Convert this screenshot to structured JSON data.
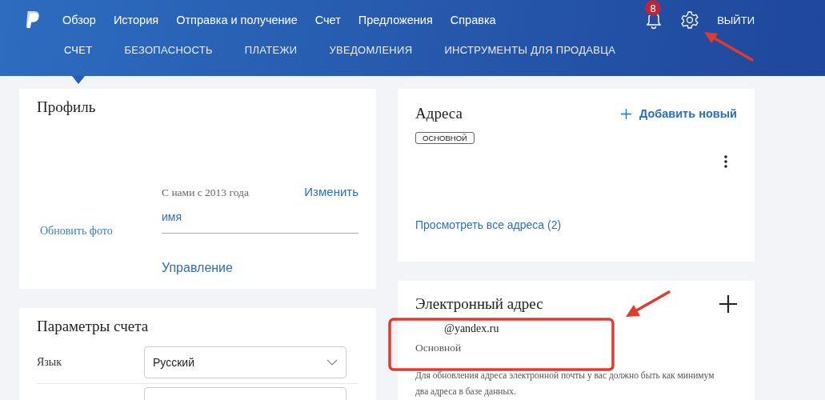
{
  "header": {
    "nav": [
      {
        "label": "Обзор"
      },
      {
        "label": "История"
      },
      {
        "label": "Отправка и получение"
      },
      {
        "label": "Счет"
      },
      {
        "label": "Предложения"
      },
      {
        "label": "Справка"
      }
    ],
    "notifications": {
      "count": "8"
    },
    "logout": "ВЫЙТИ",
    "subnav": [
      {
        "label": "СЧЕТ",
        "selected": true
      },
      {
        "label": "БЕЗОПАСНОСТЬ",
        "selected": false
      },
      {
        "label": "ПЛАТЕЖИ",
        "selected": false
      },
      {
        "label": "УВЕДОМЛЕНИЯ",
        "selected": false
      },
      {
        "label": "ИНСТРУМЕНТЫ ДЛЯ ПРОДАВЦА",
        "selected": false
      }
    ]
  },
  "profile": {
    "title": "Профиль",
    "update_photo": "Обновить фото",
    "member_since": "С нами с 2013 года",
    "edit": "Изменить",
    "name_label": "имя",
    "manage": "Управление"
  },
  "account_settings": {
    "title": "Параметры счета",
    "rows": [
      {
        "label": "Язык",
        "value": "Русский"
      }
    ]
  },
  "addresses": {
    "title": "Адреса",
    "add": "Добавить новый",
    "badge": "ОСНОВНОЙ",
    "view_all": "Просмотреть все адреса (2)"
  },
  "email": {
    "title": "Электронный адрес",
    "address": "@yandex.ru",
    "status": "Основной",
    "note": "Для обновления адреса электронной почты у вас должно быть как минимум два адреса в базе данных."
  }
}
